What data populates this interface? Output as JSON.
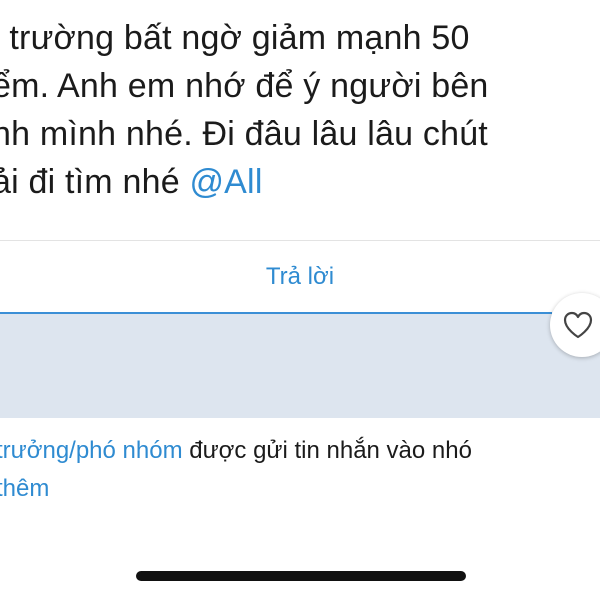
{
  "message": {
    "lines": [
      "ị trường bất ngờ giảm mạnh 50",
      "ểm. Anh em nhớ để ý người bên",
      "nh mình nhé. Đi đâu lâu lâu chút",
      "ải đi tìm nhé "
    ],
    "mention": "@All"
  },
  "reply": {
    "label": "Trả lời"
  },
  "reaction": {
    "icon": "heart-icon"
  },
  "notice": {
    "link_text": "trưởng/phó nhóm",
    "line1_rest": " được gửi tin nhắn vào nhó",
    "line2": " thêm"
  },
  "colors": {
    "accent": "#2f8bd1",
    "input_bg": "#dde5ef",
    "text": "#1b1b1b"
  }
}
